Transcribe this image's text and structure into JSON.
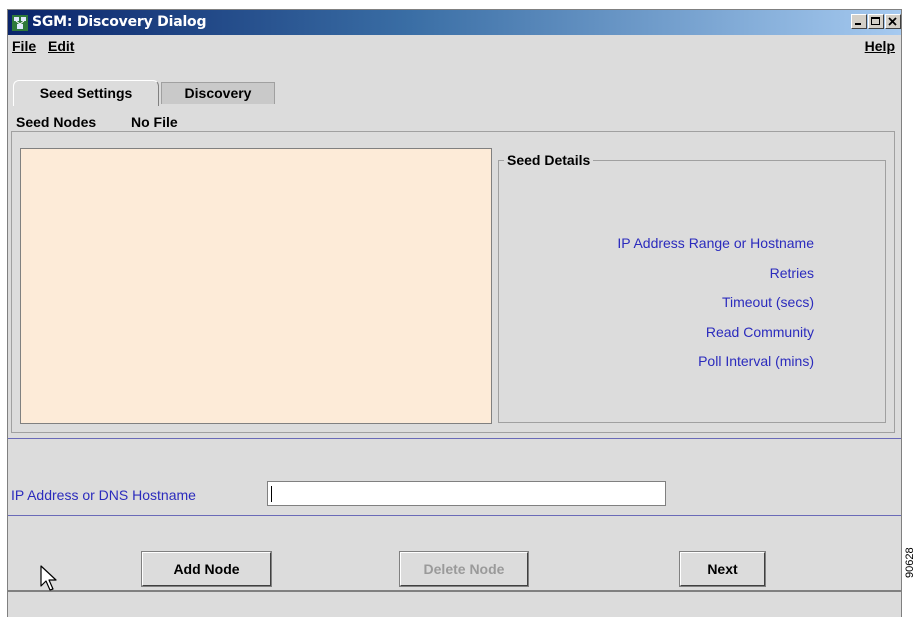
{
  "window": {
    "title": "SGM: Discovery Dialog",
    "controls": {
      "minimize": "minimize-icon",
      "maximize": "maximize-icon",
      "close": "close-icon"
    }
  },
  "menubar": {
    "file": "File",
    "edit": "Edit",
    "help": "Help"
  },
  "tabs": [
    {
      "label": "Seed Settings",
      "active": true
    },
    {
      "label": "Discovery",
      "active": false
    }
  ],
  "seed_nodes": {
    "group_title": "Seed Nodes",
    "file_status": "No File"
  },
  "seed_details": {
    "title": "Seed Details",
    "fields": [
      "IP Address Range or Hostname",
      "Retries",
      "Timeout (secs)",
      "Read Community",
      "Poll Interval (mins)"
    ]
  },
  "ip_entry": {
    "label": "IP Address or DNS Hostname",
    "value": ""
  },
  "buttons": {
    "add_node": "Add Node",
    "delete_node": "Delete Node",
    "next": "Next"
  },
  "side_id": "90628",
  "colors": {
    "window_bg": "#dcdcdc",
    "list_bg": "#fdebd8",
    "label_blue": "#2b2bbd",
    "title_gradient_start": "#0a246a"
  }
}
